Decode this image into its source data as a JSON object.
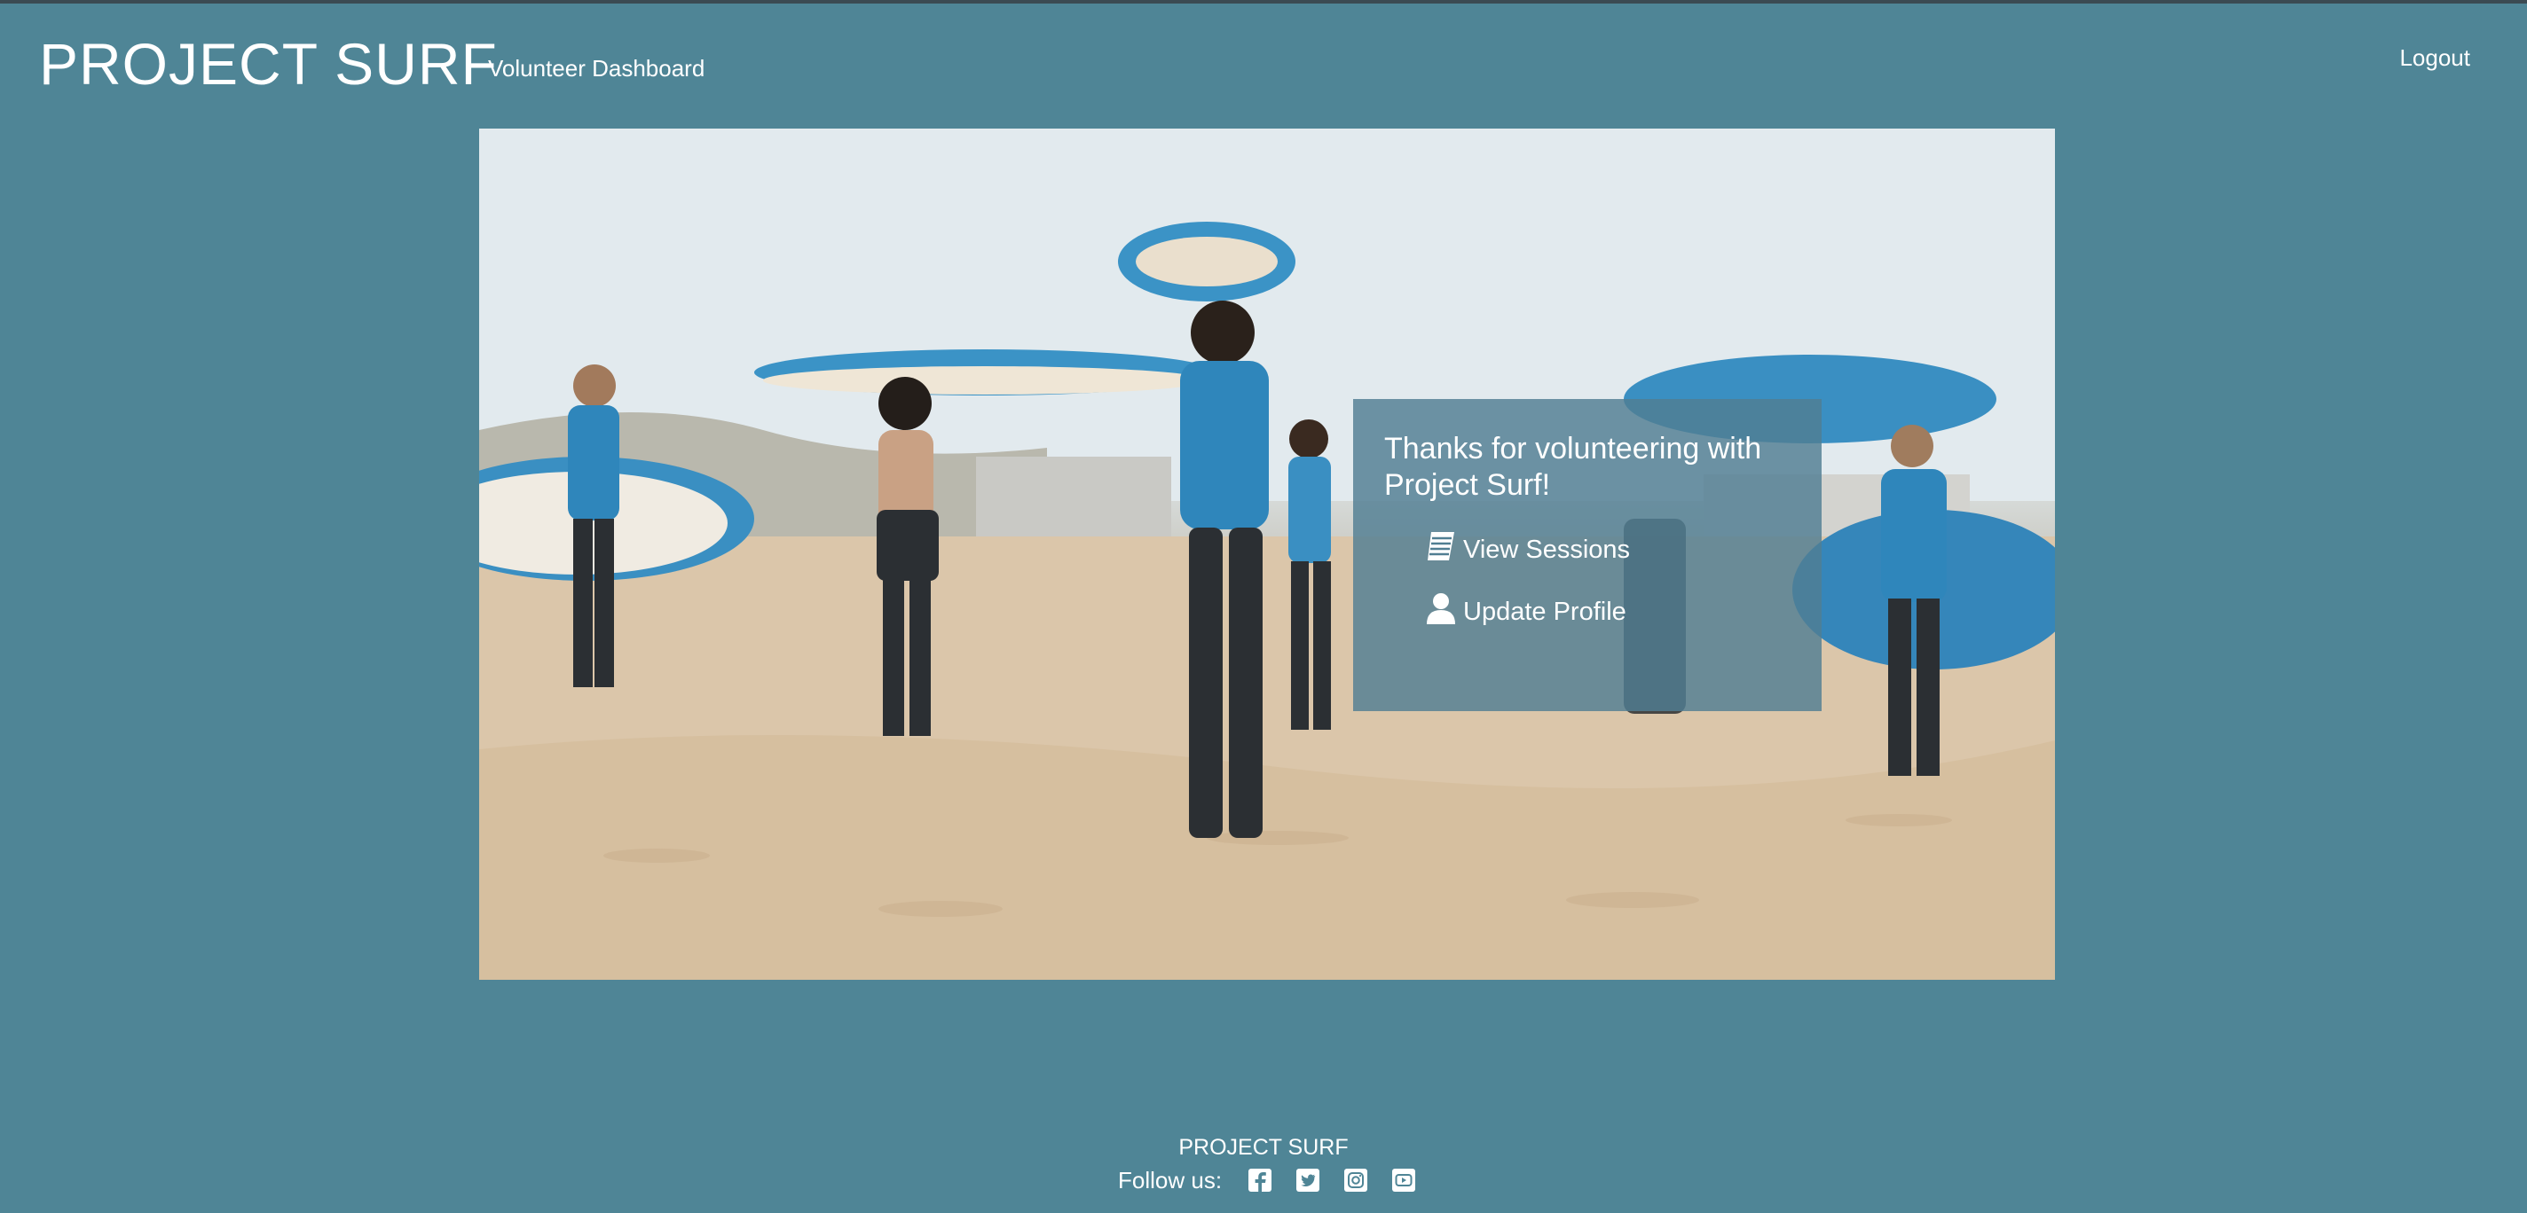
{
  "header": {
    "brand": "PROJECT SURF",
    "subtitle": "Volunteer Dashboard",
    "logout_label": "Logout"
  },
  "hero": {
    "image_desc_icon": "beach-surfers-photo",
    "panel": {
      "title": "Thanks for volunteering with Project Surf!",
      "links": [
        {
          "label": "View Sessions",
          "icon": "document-icon"
        },
        {
          "label": "Update Profile",
          "icon": "user-icon"
        }
      ]
    }
  },
  "footer": {
    "brand": "PROJECT SURF",
    "follow_label": "Follow us:",
    "social": [
      "facebook-icon",
      "twitter-icon",
      "instagram-icon",
      "youtube-icon"
    ]
  },
  "colors": {
    "background": "#4f8596",
    "panel": "#507e92",
    "text": "#ffffff"
  }
}
